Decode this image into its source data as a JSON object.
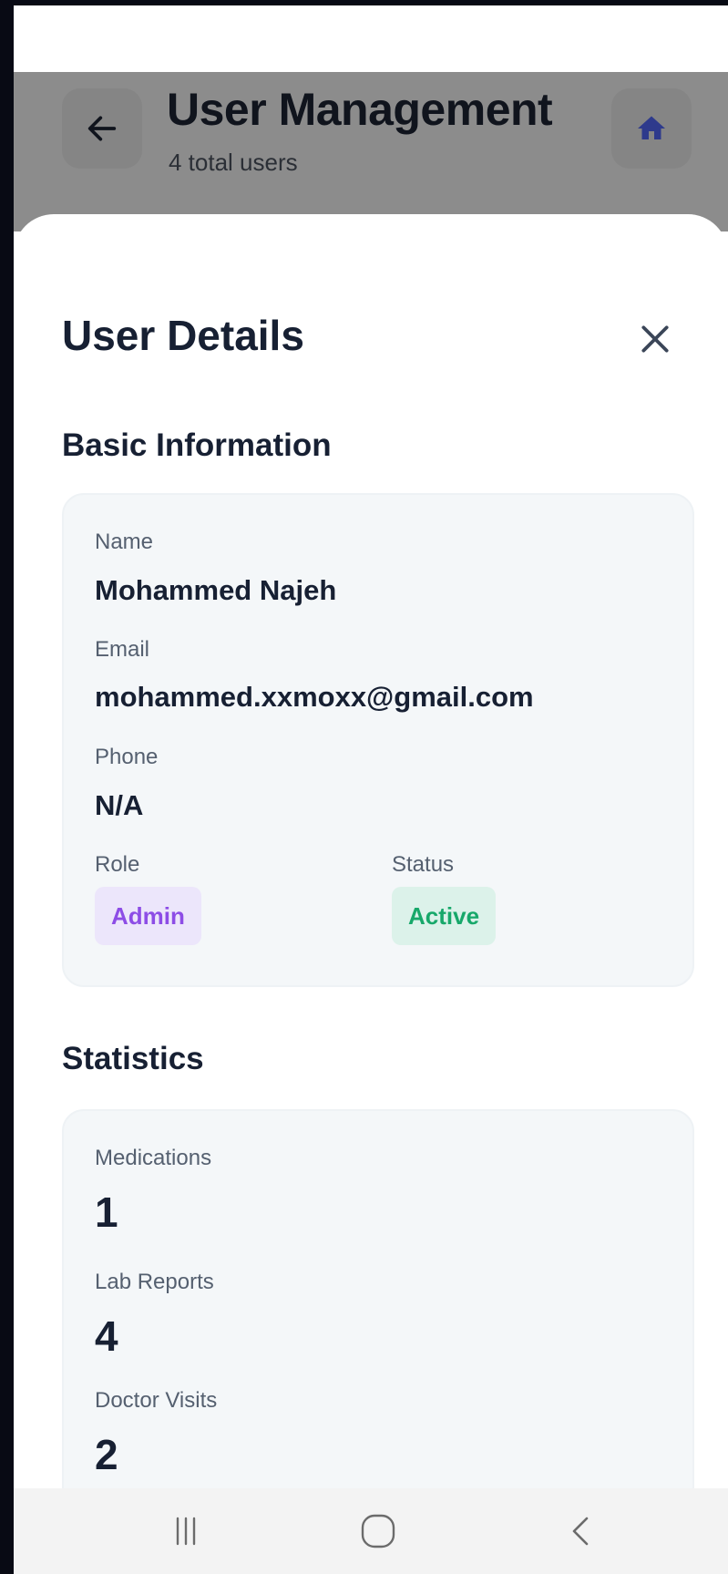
{
  "header": {
    "title": "User Management",
    "subtitle": "4 total users",
    "back_icon": "arrow-left-icon",
    "home_icon": "home-icon"
  },
  "sheet": {
    "title": "User Details",
    "close_icon": "close-icon"
  },
  "basic_info": {
    "section_title": "Basic Information",
    "name_label": "Name",
    "name_value": "Mohammed Najeh",
    "email_label": "Email",
    "email_value": "mohammed.xxmoxx@gmail.com",
    "phone_label": "Phone",
    "phone_value": "N/A",
    "role_label": "Role",
    "role_value": "Admin",
    "status_label": "Status",
    "status_value": "Active"
  },
  "statistics": {
    "section_title": "Statistics",
    "items": [
      {
        "label": "Medications",
        "value": "1"
      },
      {
        "label": "Lab Reports",
        "value": "4"
      },
      {
        "label": "Doctor Visits",
        "value": "2"
      }
    ]
  },
  "nav_bar": {
    "recents_icon": "recent-apps-icon",
    "home_icon": "home-circle-icon",
    "back_icon": "back-chevron-icon"
  },
  "colors": {
    "primary_text": "#172033",
    "home_icon": "#2e3a8c",
    "role_badge_bg": "#ece6fb",
    "role_badge_text": "#8d4de6",
    "status_badge_bg": "#dcf2ea",
    "status_badge_text": "#17a86a"
  }
}
